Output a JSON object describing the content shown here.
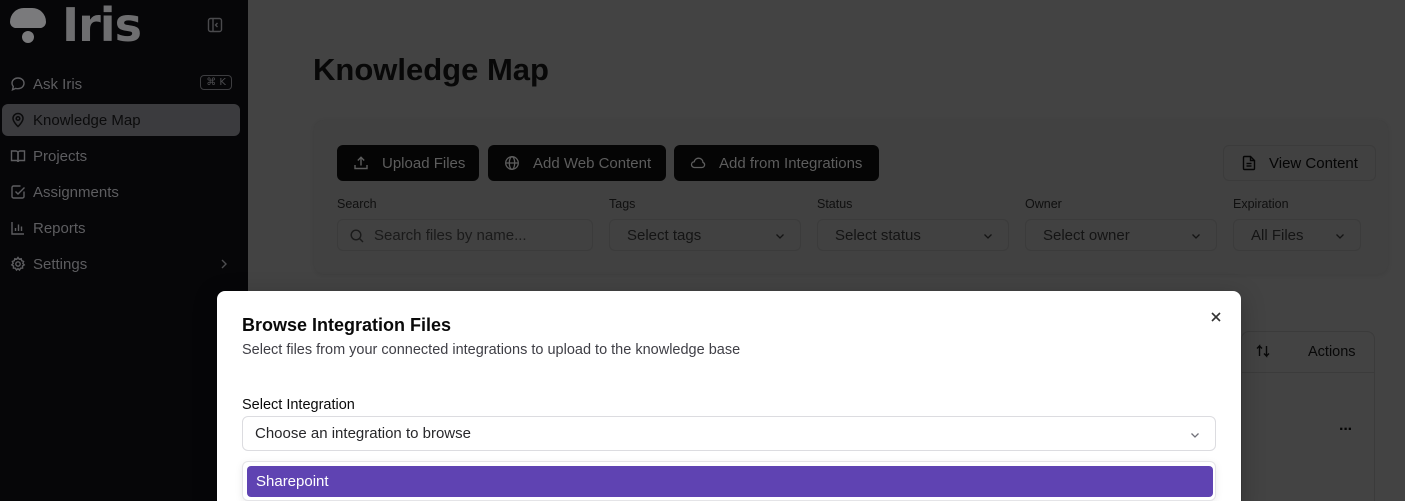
{
  "app": {
    "logo_text": "Iris"
  },
  "sidebar": {
    "items": [
      {
        "label": "Ask Iris",
        "icon": "chat-bubble-icon",
        "shortcut": "⌘ K"
      },
      {
        "label": "Knowledge Map",
        "icon": "map-pin-icon",
        "active": true
      },
      {
        "label": "Projects",
        "icon": "book-open-icon"
      },
      {
        "label": "Assignments",
        "icon": "check-square-icon"
      },
      {
        "label": "Reports",
        "icon": "bar-chart-icon"
      },
      {
        "label": "Settings",
        "icon": "gear-icon",
        "expandable": true
      }
    ]
  },
  "main": {
    "title": "Knowledge Map",
    "toolbar": {
      "upload_label": "Upload Files",
      "web_label": "Add Web Content",
      "integrations_label": "Add from Integrations",
      "view_label": "View Content"
    },
    "filters": {
      "search": {
        "label": "Search",
        "placeholder": "Search files by name..."
      },
      "tags": {
        "label": "Tags",
        "value": "Select tags"
      },
      "status": {
        "label": "Status",
        "value": "Select status"
      },
      "owner": {
        "label": "Owner",
        "value": "Select owner"
      },
      "expiration": {
        "label": "Expiration",
        "value": "All Files"
      }
    },
    "table": {
      "actions_header": "Actions",
      "row_action": "···"
    }
  },
  "modal": {
    "title": "Browse Integration Files",
    "subtitle": "Select files from your connected integrations to upload to the knowledge base",
    "select_label": "Select Integration",
    "select_placeholder": "Choose an integration to browse",
    "options": [
      "Sharepoint"
    ],
    "highlighted_option": "Sharepoint",
    "accent_color": "#5f43b2"
  }
}
